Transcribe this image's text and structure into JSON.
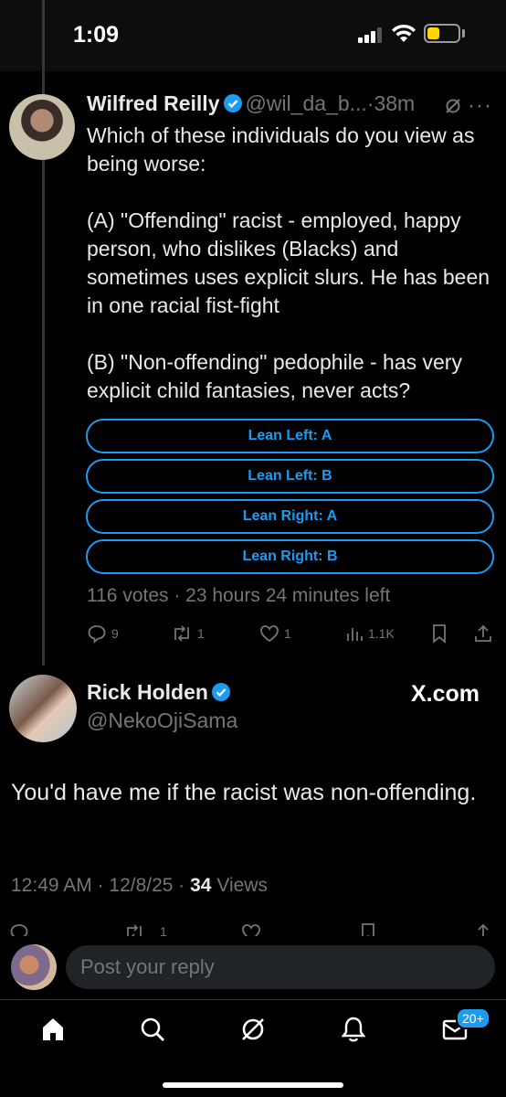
{
  "status_bar": {
    "time": "1:09"
  },
  "tweet": {
    "author_name": "Wilfred Reilly",
    "handle": "@wil_da_b...",
    "age": "·38m",
    "text": "Which of these individuals do you view as being worse:\n\n(A) \"Offending\" racist - employed, happy person, who dislikes (Blacks) and sometimes uses explicit slurs. He has been in one racial fist-fight\n\n(B) \"Non-offending\" pedophile - has very explicit child fantasies, never acts?",
    "poll": {
      "options": [
        "Lean Left: A",
        "Lean Left: B",
        "Lean Right: A",
        "Lean Right: B"
      ],
      "meta": "116 votes · 23 hours 24 minutes left"
    },
    "actions": {
      "replies": "9",
      "reposts": "1",
      "likes": "1",
      "views": "1.1K"
    }
  },
  "reply": {
    "author_name": "Rick Holden",
    "handle": "@NekoOjiSama",
    "watermark": "X.com",
    "text": "You'd have me if the racist was non-offending.",
    "timestamp": "12:49 AM · 12/8/25 · ",
    "views_count": "34",
    "views_label": " Views",
    "reposts": "1"
  },
  "composer": {
    "placeholder": "Post your reply"
  },
  "tabbar": {
    "messages_badge": "20+"
  },
  "colors": {
    "accent": "#1d9bf0",
    "background": "#000000",
    "muted": "#71767b"
  },
  "icons": [
    "home-icon",
    "search-icon",
    "grok-icon",
    "bell-icon",
    "mail-icon"
  ]
}
